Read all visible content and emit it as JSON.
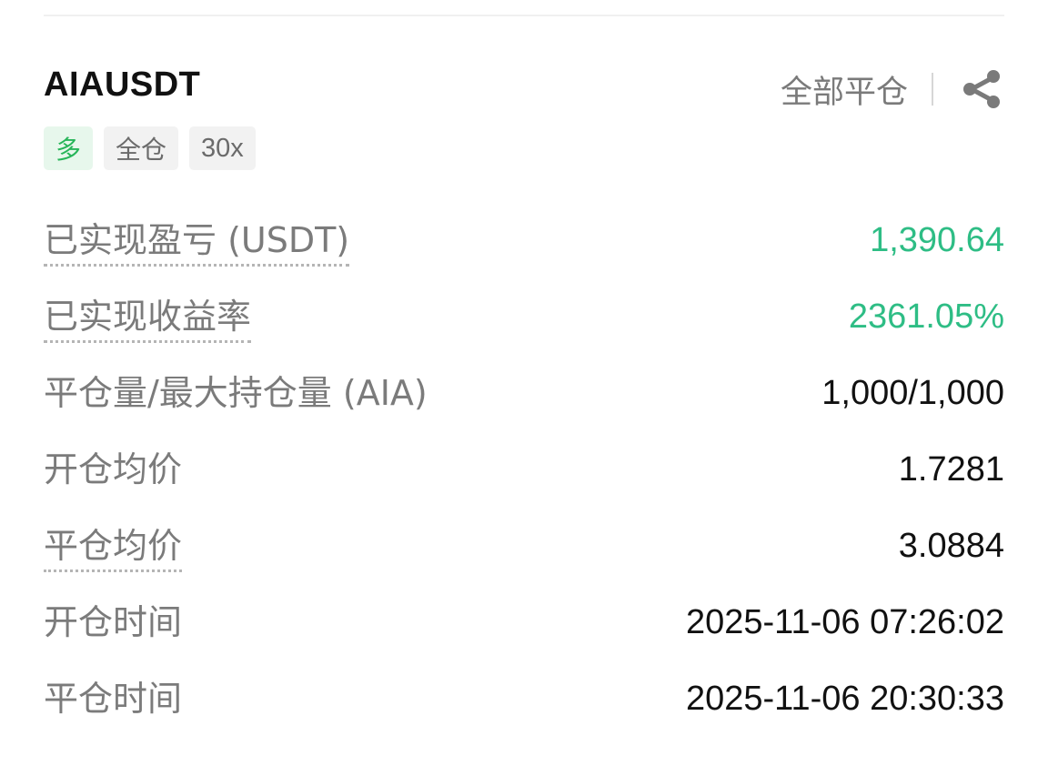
{
  "position": {
    "symbol": "AIAUSDT",
    "close_all_label": "全部平仓",
    "share_icon": "share-icon",
    "tags": {
      "side": "多",
      "margin_mode": "全仓",
      "leverage": "30x"
    }
  },
  "details": [
    {
      "label": "已实现盈亏 (USDT)",
      "value": "1,390.64"
    },
    {
      "label": "已实现收益率",
      "value": "2361.05%"
    },
    {
      "label": "平仓量/最大持仓量 (AIA)",
      "value": "1,000/1,000"
    },
    {
      "label": "开仓均价",
      "value": "1.7281"
    },
    {
      "label": "平仓均价",
      "value": "3.0884"
    },
    {
      "label": "开仓时间",
      "value": "2025-11-06 07:26:02"
    },
    {
      "label": "平仓时间",
      "value": "2025-11-06 20:30:33"
    }
  ],
  "colors": {
    "profit": "#2ebd85",
    "long_tag_text": "#27b559",
    "long_tag_bg": "#e7f7ec"
  }
}
